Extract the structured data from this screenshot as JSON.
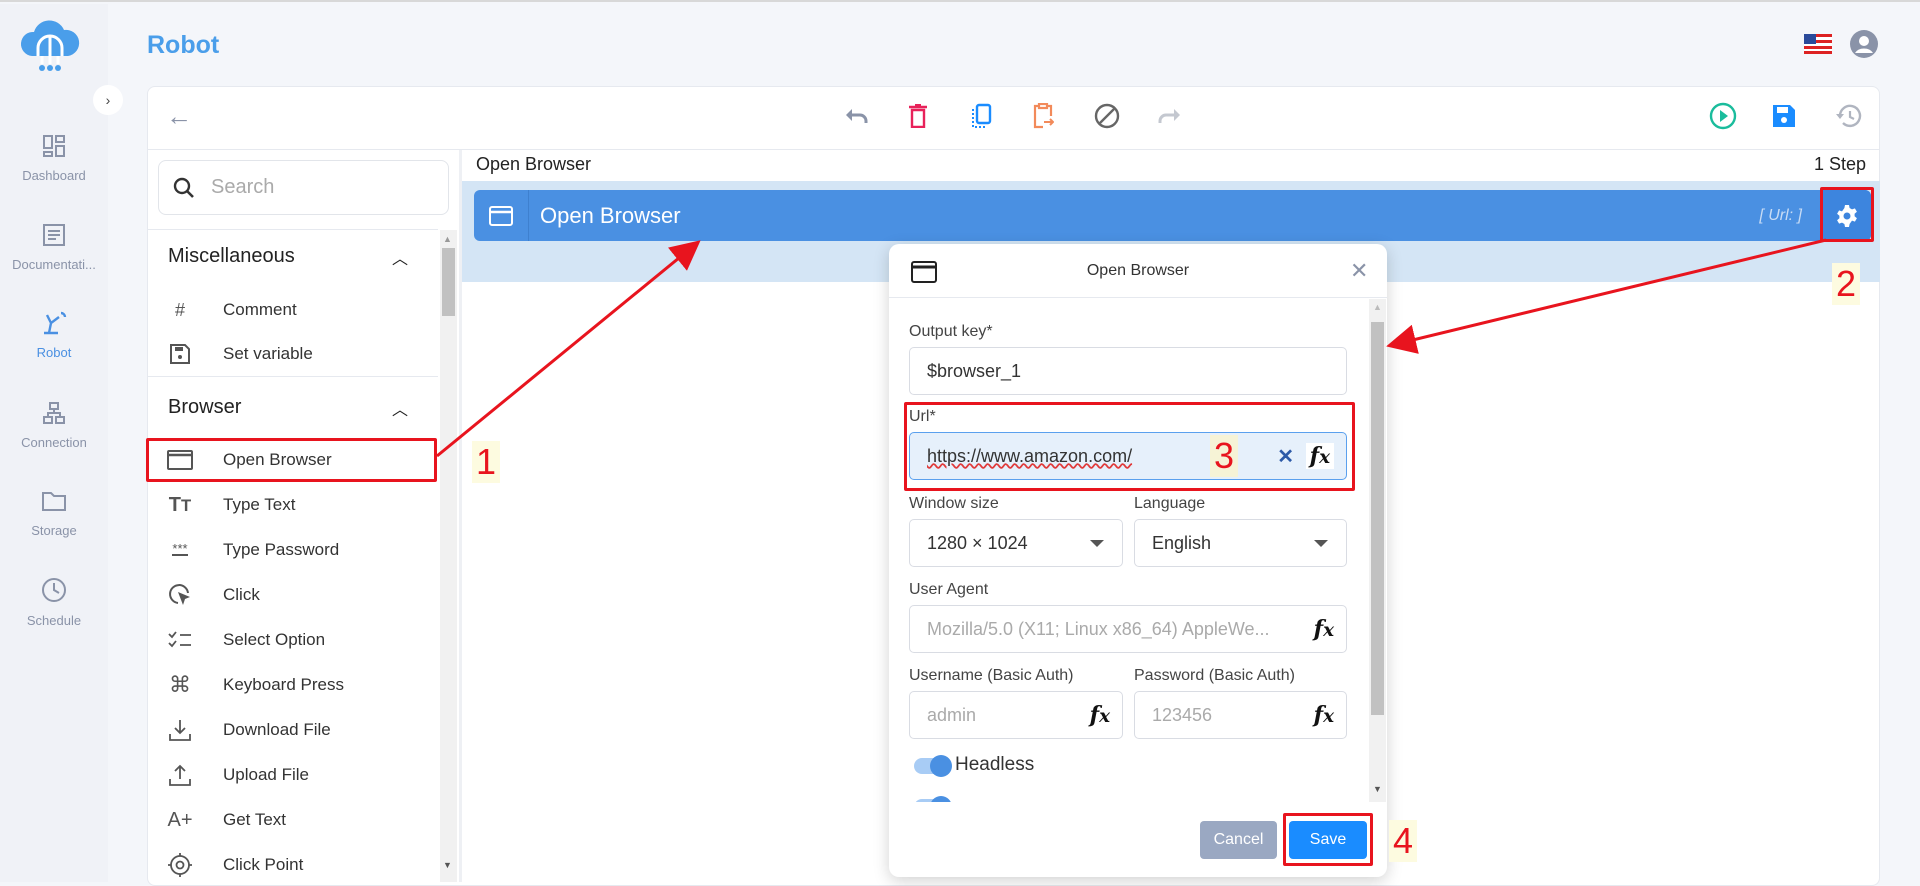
{
  "app": {
    "title": "Robot"
  },
  "sidebar": {
    "items": [
      {
        "label": "Dashboard",
        "icon": "dashboard-icon"
      },
      {
        "label": "Documentati...",
        "icon": "document-icon"
      },
      {
        "label": "Robot",
        "icon": "robot-arm-icon",
        "active": true
      },
      {
        "label": "Connection",
        "icon": "sitemap-icon"
      },
      {
        "label": "Storage",
        "icon": "folder-icon"
      },
      {
        "label": "Schedule",
        "icon": "clock-icon"
      }
    ]
  },
  "toolbar": {
    "icons": [
      "undo-icon",
      "delete-icon",
      "duplicate-icon",
      "paste-icon",
      "disable-icon",
      "redo-icon",
      "run-icon",
      "save-icon",
      "history-icon"
    ]
  },
  "search": {
    "placeholder": "Search"
  },
  "groups": [
    {
      "label": "Miscellaneous",
      "items": [
        {
          "label": "Comment",
          "icon": "#"
        },
        {
          "label": "Set variable",
          "icon": "floppy"
        }
      ]
    },
    {
      "label": "Browser",
      "items": [
        {
          "label": "Open Browser",
          "icon": "window"
        },
        {
          "label": "Type Text",
          "icon": "TT"
        },
        {
          "label": "Type Password",
          "icon": "***"
        },
        {
          "label": "Click",
          "icon": "click"
        },
        {
          "label": "Select Option",
          "icon": "checklist"
        },
        {
          "label": "Keyboard Press",
          "icon": "⌘"
        },
        {
          "label": "Download File",
          "icon": "download"
        },
        {
          "label": "Upload File",
          "icon": "upload"
        },
        {
          "label": "Get Text",
          "icon": "A+"
        },
        {
          "label": "Click Point",
          "icon": "target"
        }
      ]
    }
  ],
  "canvas": {
    "breadcrumb": "Open Browser",
    "step_count": "1 Step",
    "step": {
      "name": "Open Browser",
      "params": "[ Url: ]"
    }
  },
  "dialog": {
    "title": "Open Browser",
    "output_key": {
      "label": "Output key*",
      "value": "$browser_1"
    },
    "url": {
      "label": "Url*",
      "value": "https://www.amazon.com/"
    },
    "window_size": {
      "label": "Window size",
      "value": "1280 × 1024"
    },
    "language": {
      "label": "Language",
      "value": "English"
    },
    "user_agent": {
      "label": "User Agent",
      "placeholder": "Mozilla/5.0 (X11; Linux x86_64) AppleWe..."
    },
    "username": {
      "label": "Username (Basic Auth)",
      "placeholder": "admin"
    },
    "password": {
      "label": "Password (Basic Auth)",
      "placeholder": "123456"
    },
    "headless": {
      "label": "Headless",
      "on": true
    },
    "cancel": "Cancel",
    "save": "Save"
  },
  "annotations": [
    "1",
    "2",
    "3",
    "4"
  ],
  "colors": {
    "accent": "#4a90e2",
    "annotation": "#e8141e",
    "save": "#1a8cff",
    "cancel": "#9aa8c2"
  }
}
